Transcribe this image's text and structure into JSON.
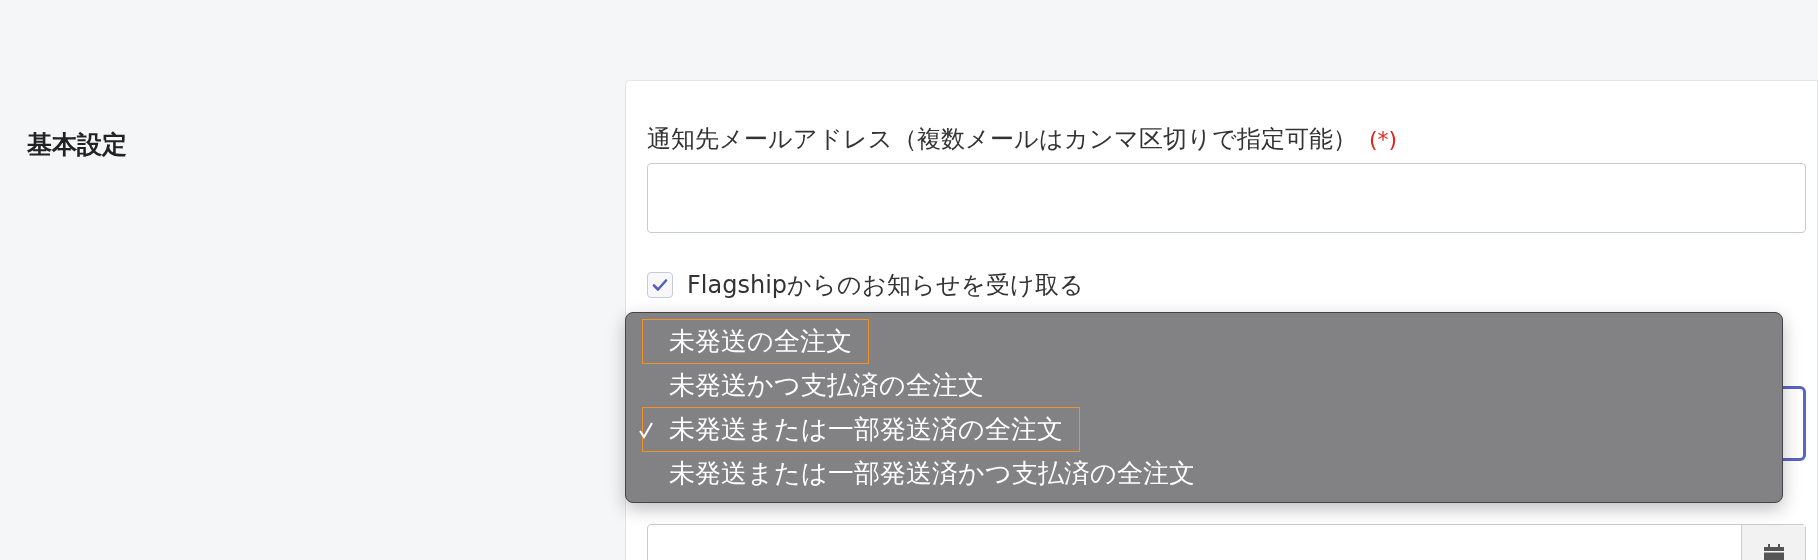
{
  "section_title": "基本設定",
  "email_field": {
    "label": "通知先メールアドレス（複数メールはカンマ区切りで指定可能）",
    "required_mark": "(*)"
  },
  "notice_checkbox": {
    "label": "Flagshipからのお知らせを受け取る",
    "checked": true
  },
  "order_select": {
    "options": [
      {
        "label": "未発送の全注文",
        "selected": false,
        "highlighted": true
      },
      {
        "label": "未発送かつ支払済の全注文",
        "selected": false,
        "highlighted": false
      },
      {
        "label": "未発送または一部発送済の全注文",
        "selected": true,
        "highlighted": true
      },
      {
        "label": "未発送または一部発送済かつ支払済の全注文",
        "selected": false,
        "highlighted": false
      }
    ]
  }
}
